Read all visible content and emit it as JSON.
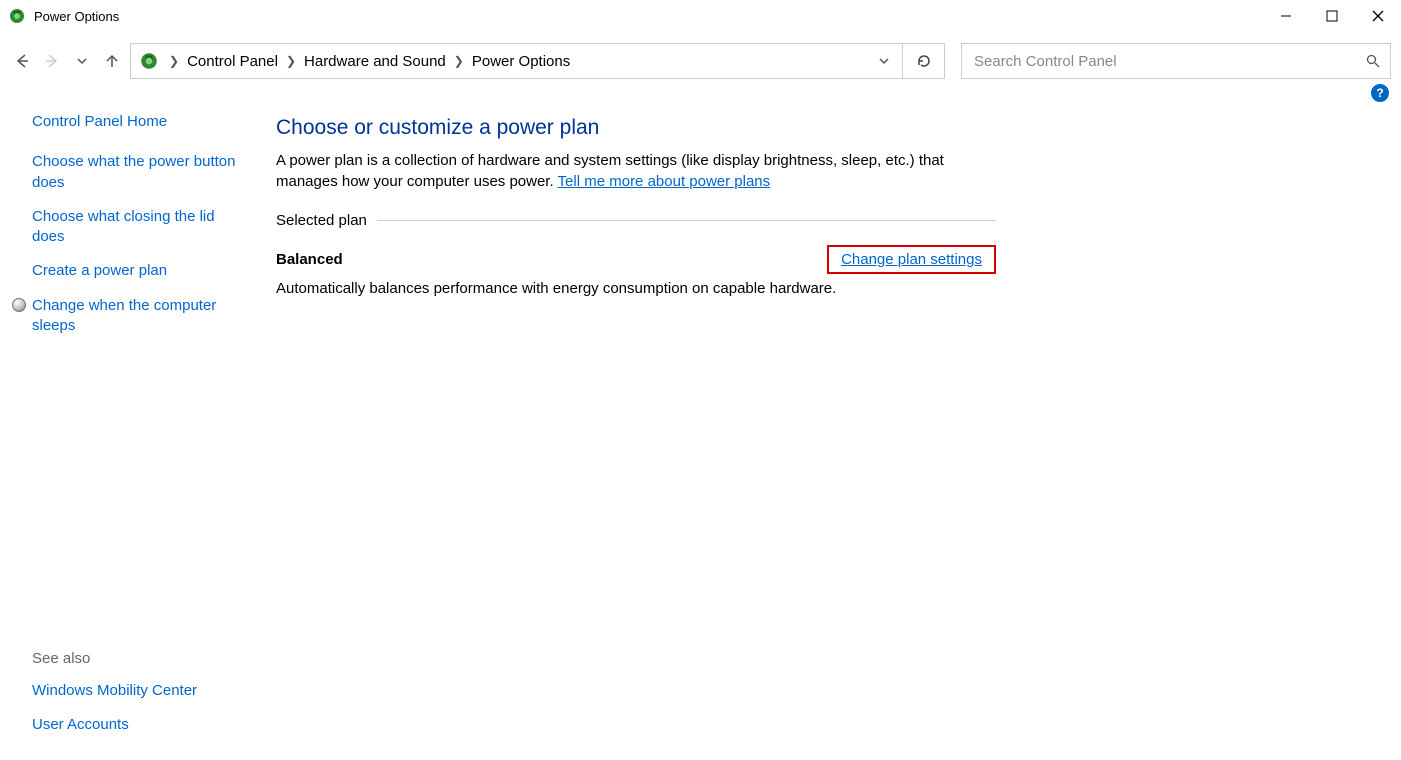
{
  "window": {
    "title": "Power Options"
  },
  "breadcrumbs": {
    "items": [
      "Control Panel",
      "Hardware and Sound",
      "Power Options"
    ]
  },
  "search": {
    "placeholder": "Search Control Panel"
  },
  "sidebar": {
    "home": "Control Panel Home",
    "links": [
      "Choose what the power button does",
      "Choose what closing the lid does",
      "Create a power plan",
      "Change when the computer sleeps"
    ],
    "see_also_label": "See also",
    "see_also": [
      "Windows Mobility Center",
      "User Accounts"
    ]
  },
  "main": {
    "heading": "Choose or customize a power plan",
    "description_pre": "A power plan is a collection of hardware and system settings (like display brightness, sleep, etc.) that manages how your computer uses power. ",
    "tell_me_more": "Tell me more about power plans",
    "selected_plan_label": "Selected plan",
    "plan": {
      "name": "Balanced",
      "change_link": "Change plan settings",
      "description": "Automatically balances performance with energy consumption on capable hardware."
    }
  }
}
